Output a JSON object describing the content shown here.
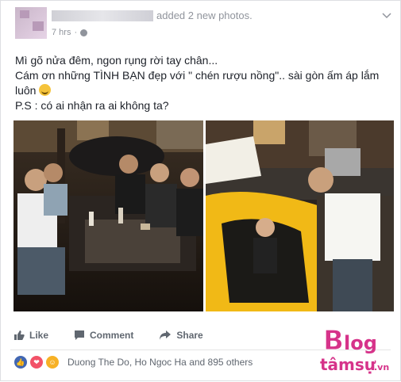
{
  "post": {
    "action_text": "added 2 new photos.",
    "time": "7 hrs",
    "time_sep": "·",
    "caption_lines": [
      "Mì gõ nửa đêm, ngon rụng rời tay chân...",
      "Cám ơn những TÌNH BẠN đẹp với \" chén rượu nồng\".. sài gòn ấm áp lắm luôn",
      "P.S : có ai nhận ra ai không ta?"
    ]
  },
  "actions": {
    "like": "Like",
    "comment": "Comment",
    "share": "Share"
  },
  "reactions": {
    "text": "Duong The Do, Ho Ngoc Ha and 895 others",
    "types": [
      "like-icon",
      "love-icon",
      "haha-icon"
    ],
    "colors": {
      "like": "#4267b2",
      "love": "#f25268",
      "haha": "#f7b125"
    }
  },
  "watermark": {
    "top": "Blog",
    "bottom": "tâmsự",
    "suffix": ".vn",
    "color": "#d6338a"
  }
}
